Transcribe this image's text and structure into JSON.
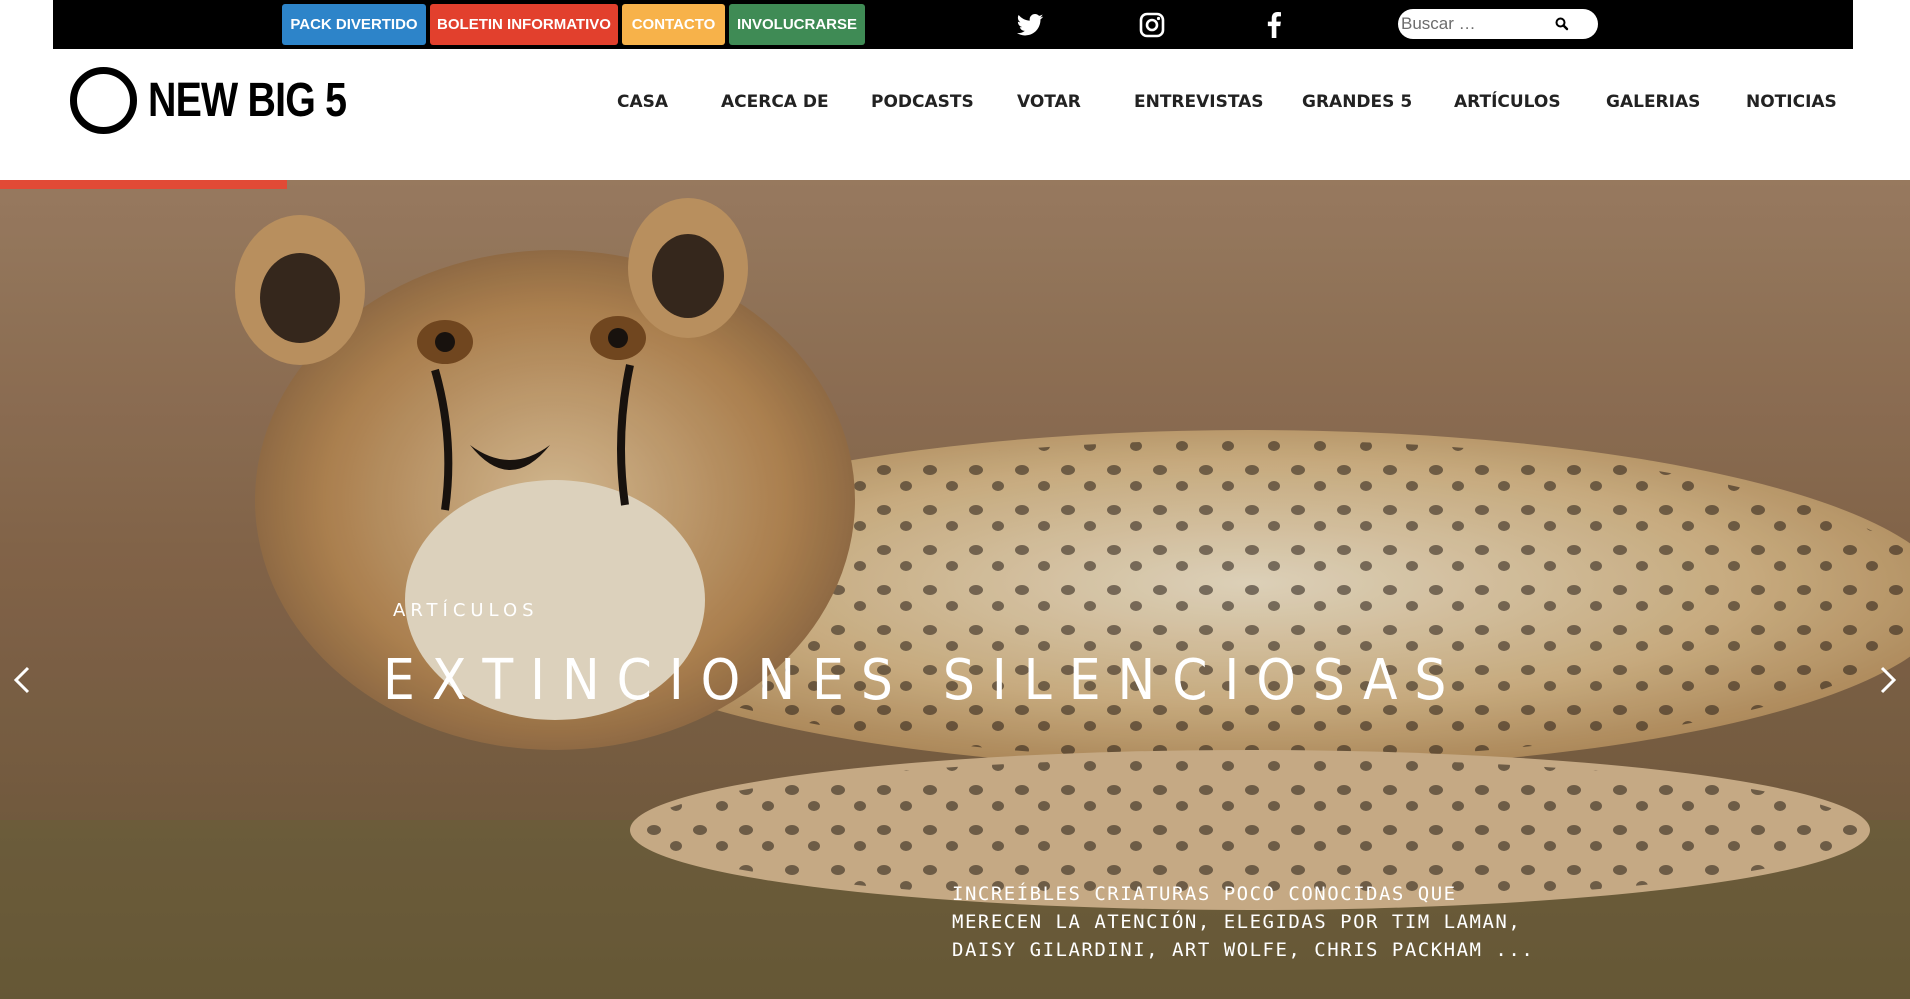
{
  "topbar": {
    "buttons": [
      {
        "label": "PACK DIVERTIDO",
        "color": "#2d84c9"
      },
      {
        "label": "BOLETIN INFORMATIVO",
        "color": "#e2402d"
      },
      {
        "label": "CONTACTO",
        "color": "#f7b24a"
      },
      {
        "label": "INVOLUCRARSE",
        "color": "#3f8b55"
      }
    ],
    "social": [
      "twitter-icon",
      "instagram-icon",
      "facebook-icon"
    ],
    "search": {
      "placeholder": "Buscar …",
      "value": ""
    }
  },
  "header": {
    "logo_text": "NEW BIG 5",
    "nav": [
      "CASA",
      "ACERCA DE",
      "PODCASTS",
      "VOTAR",
      "ENTREVISTAS",
      "GRANDES 5",
      "ARTÍCULOS",
      "GALERIAS",
      "NOTICIAS"
    ]
  },
  "hero": {
    "category": "ARTÍCULOS",
    "title": "EXTINCIONES SILENCIOSAS",
    "excerpt": "INCREÍBLES CRIATURAS POCO CONOCIDAS QUE MERECEN LA ATENCIÓN, ELEGIDAS POR TIM LAMAN, DAISY GILARDINI, ART WOLFE, CHRIS PACKHAM ...",
    "image": "cheetah cub lying on grass",
    "slide_progress": 0.15,
    "accent_color": "#e24a36"
  }
}
